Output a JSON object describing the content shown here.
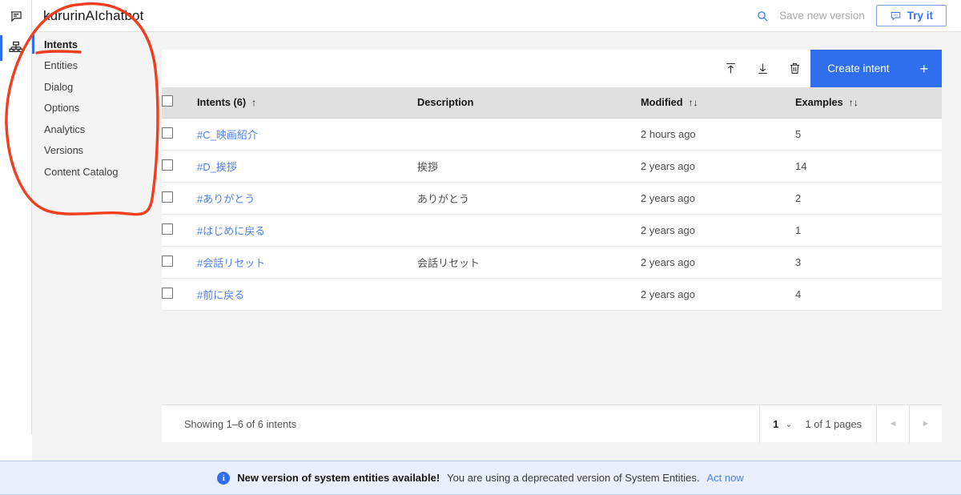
{
  "window": {
    "title": "kururinAIchatbot"
  },
  "rail": {
    "items": [
      {
        "name": "assistant-chat-icon",
        "label": "Assistant"
      },
      {
        "name": "skill-tree-icon",
        "label": "Skill",
        "active": true
      }
    ]
  },
  "header": {
    "search_icon": "search-icon",
    "save_version_label": "Save new version",
    "try_it_label": "Try it",
    "try_it_icon": "chat-bubble-icon"
  },
  "sidebar": {
    "items": [
      {
        "label": "Intents",
        "active": true
      },
      {
        "label": "Entities",
        "active": false
      },
      {
        "label": "Dialog",
        "active": false
      },
      {
        "label": "Options",
        "active": false
      },
      {
        "label": "Analytics",
        "active": false
      },
      {
        "label": "Versions",
        "active": false
      },
      {
        "label": "Content Catalog",
        "active": false
      }
    ]
  },
  "toolbar": {
    "icons": [
      {
        "name": "upload-icon",
        "label": "Upload"
      },
      {
        "name": "download-icon",
        "label": "Download"
      },
      {
        "name": "delete-icon",
        "label": "Delete"
      }
    ],
    "create_label": "Create intent",
    "create_plus": "+"
  },
  "table": {
    "columns": [
      {
        "key": "name",
        "label": "Intents (6)",
        "sort": "↑"
      },
      {
        "key": "description",
        "label": "Description",
        "sort": ""
      },
      {
        "key": "modified",
        "label": "Modified",
        "sort": "↑↓"
      },
      {
        "key": "examples",
        "label": "Examples",
        "sort": "↑↓"
      }
    ],
    "rows": [
      {
        "name": "#C_映画紹介",
        "description": "",
        "modified": "2 hours ago",
        "examples": "5"
      },
      {
        "name": "#D_挨拶",
        "description": "挨拶",
        "modified": "2 years ago",
        "examples": "14"
      },
      {
        "name": "#ありがとう",
        "description": "ありがとう",
        "modified": "2 years ago",
        "examples": "2"
      },
      {
        "name": "#はじめに戻る",
        "description": "",
        "modified": "2 years ago",
        "examples": "1"
      },
      {
        "name": "#会話リセット",
        "description": "会話リセット",
        "modified": "2 years ago",
        "examples": "3"
      },
      {
        "name": "#前に戻る",
        "description": "",
        "modified": "2 years ago",
        "examples": "4"
      }
    ]
  },
  "pagination": {
    "showing": "Showing 1–6 of 6 intents",
    "page_value": "1",
    "caret": "⌄",
    "pages_label": "1 of 1 pages",
    "prev_glyph": "◄",
    "next_glyph": "►"
  },
  "notification": {
    "icon": "info-icon",
    "info_glyph": "i",
    "title": "New version of system entities available!",
    "body": "You are using a deprecated version of System Entities.",
    "link": "Act now"
  },
  "colors": {
    "accent_blue": "#2f6fed",
    "link_blue": "#4d7fe8",
    "page_bg": "#f4f4f4",
    "table_header_bg": "#e0e0e0",
    "notif_bg": "#e9f0fb",
    "annotation_red": "#f03e1e"
  },
  "annotation": {
    "shape": "hand-drawn-ellipse-around-sidebar",
    "underline": "hand-drawn-underline-under-intents"
  }
}
